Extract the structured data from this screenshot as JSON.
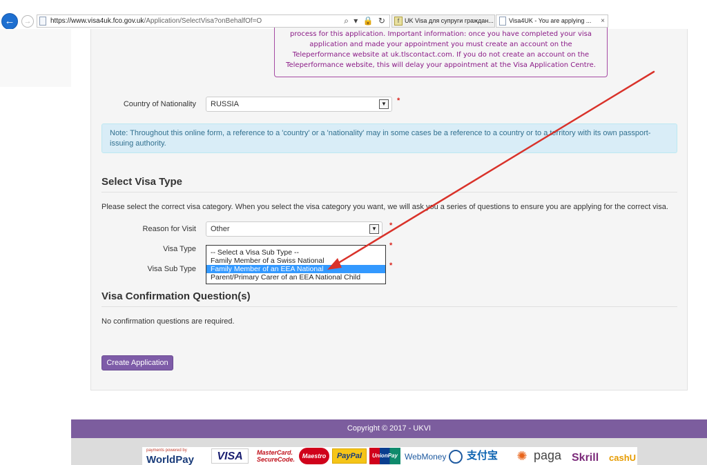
{
  "browser": {
    "url_prefix": "https://www.visa4uk.",
    "url_domain": "fco.gov.uk",
    "url_path": "/Application/SelectVisa?onBehalfOf=O",
    "address_tools": "⌕ ▾ 🔒 ↻",
    "tabs": [
      {
        "title": "UK Visa для супруги граждан..."
      },
      {
        "title": "Visa4UK - You are applying ..."
      }
    ],
    "tab_close": "×"
  },
  "notice": {
    "text": "process for this application. Important information: once you have completed your visa application and made your appointment you must create an account on the Teleperformance website at uk.tlscontact.com. If you do not create an account on the Teleperformance website, this will delay your appointment at the Visa Application Centre."
  },
  "nationality": {
    "label": "Country of Nationality",
    "value": "RUSSIA",
    "required": "*"
  },
  "info_note": "Note: Throughout this online form, a reference to a 'country' or a 'nationality' may in some cases be a reference to a country or to a territory with its own passport-issuing authority.",
  "select_visa": {
    "title": "Select Visa Type",
    "intro": "Please select the correct visa category. When you select the visa category you want, we will ask you a series of questions to ensure you are applying for the correct visa.",
    "reason_label": "Reason for Visit",
    "reason_value": "Other",
    "visa_type_label": "Visa Type",
    "visa_sub_type_label": "Visa Sub Type",
    "required": "*",
    "sub_type_options": [
      "-- Select a Visa Sub Type --",
      "Family Member of a Swiss National",
      "Family Member of an EEA National",
      "Parent/Primary Carer of an EEA National Child"
    ],
    "selected_option": "Family Member of an EEA National"
  },
  "confirmation": {
    "title": "Visa Confirmation Question(s)",
    "text": "No confirmation questions are required."
  },
  "create_button": "Create Application",
  "footer": {
    "copyright": "Copyright © 2017 - UKVI"
  },
  "payment_logos": {
    "worldpay_small": "payments powered by",
    "worldpay": "WorldPay",
    "visa": "VISA",
    "mastercard_1": "MasterCard.",
    "mastercard_2": "SecureCode.",
    "maestro": "Maestro",
    "paypal": "PayPal",
    "unionpay": "UnionPay",
    "webmoney": "WebMoney",
    "alipay": "支付宝",
    "paga": "paga",
    "skrill": "Skrill",
    "cashu": "cashU"
  },
  "colors": {
    "accent_purple": "#7e5ca8",
    "notice_text": "#8a1a86",
    "info_bg": "#d9edf7",
    "info_text": "#31708f",
    "required_red": "#d9241d",
    "annotation_arrow": "#d9322a",
    "selected_option_bg": "#3399ff"
  }
}
